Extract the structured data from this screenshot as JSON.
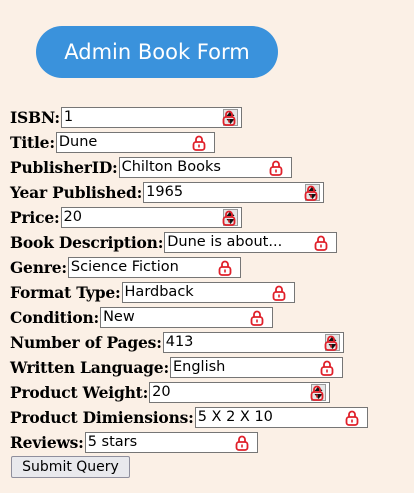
{
  "header": {
    "title": "Admin Book Form"
  },
  "fields": {
    "isbn": {
      "label": "ISBN:",
      "value": "1"
    },
    "title": {
      "label": "Title:",
      "value": "Dune"
    },
    "publisher_id": {
      "label": "PublisherID:",
      "value": "Chilton Books"
    },
    "year_published": {
      "label": "Year Published:",
      "value": "1965"
    },
    "price": {
      "label": "Price:",
      "value": "20"
    },
    "book_description": {
      "label": "Book Description:",
      "value": "Dune is about..."
    },
    "genre": {
      "label": "Genre:",
      "value": "Science Fiction"
    },
    "format_type": {
      "label": "Format Type:",
      "value": "Hardback"
    },
    "condition": {
      "label": "Condition:",
      "value": "New"
    },
    "number_of_pages": {
      "label": "Number of Pages:",
      "value": "413"
    },
    "written_language": {
      "label": "Written Language:",
      "value": "English"
    },
    "product_weight": {
      "label": "Product Weight:",
      "value": "20"
    },
    "product_dimensions": {
      "label": "Product Dimiensions:",
      "value": "5 X 2 X 10"
    },
    "reviews": {
      "label": "Reviews:",
      "value": "5 stars"
    }
  },
  "submit": {
    "label": "Submit Query"
  },
  "colors": {
    "accent": "#3a92dc",
    "lock_icon": "#e0202a",
    "background": "#fbf0e6"
  },
  "icons": {
    "text_field": "password-manager-lock-icon",
    "number_field": "spinner-icon"
  }
}
